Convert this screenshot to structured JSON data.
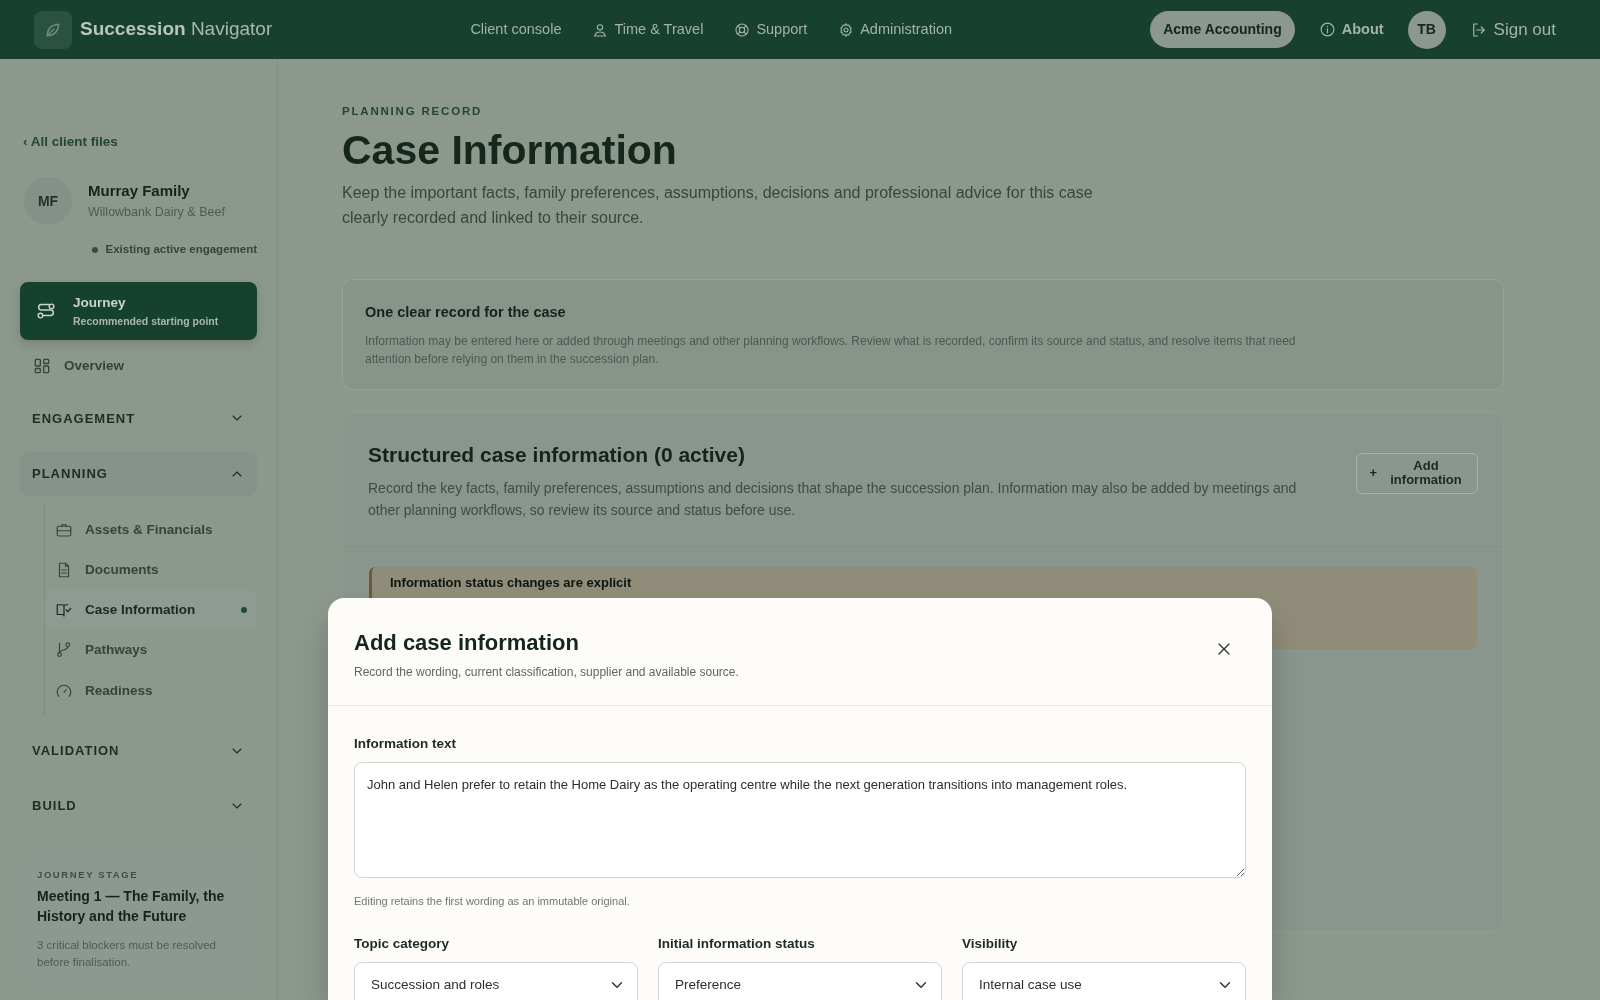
{
  "navbar": {
    "brand_bold": "Succession",
    "brand_light": "Navigator",
    "links": [
      {
        "label": "Client console"
      },
      {
        "label": "Time & Travel"
      },
      {
        "label": "Support"
      },
      {
        "label": "Administration"
      }
    ],
    "organisation": "Acme Accounting",
    "about": "About",
    "avatar": "TB",
    "sign_out": "Sign out"
  },
  "sidebar": {
    "back_link": "‹ All client files",
    "client": {
      "initials": "MF",
      "name": "Murray Family",
      "business": "Willowbank Dairy & Beef",
      "status": "Existing active engagement"
    },
    "journey": {
      "title": "Journey",
      "subtitle": "Recommended starting point"
    },
    "overview": "Overview",
    "sections": [
      {
        "label": "ENGAGEMENT",
        "expanded": false
      },
      {
        "label": "PLANNING",
        "expanded": true,
        "items": [
          {
            "label": "Assets & Financials",
            "selected": false
          },
          {
            "label": "Documents",
            "selected": false
          },
          {
            "label": "Case Information",
            "selected": true
          },
          {
            "label": "Pathways",
            "selected": false
          },
          {
            "label": "Readiness",
            "selected": false
          }
        ]
      },
      {
        "label": "VALIDATION",
        "expanded": false
      },
      {
        "label": "BUILD",
        "expanded": false
      }
    ],
    "stage": {
      "eyebrow": "JOURNEY STAGE",
      "title": "Meeting 1 — The Family, the History and the Future",
      "note": "3 critical blockers must be resolved before finalisation."
    }
  },
  "main": {
    "eyebrow": "PLANNING RECORD",
    "title": "Case Information",
    "intro": "Keep the important facts, family preferences, assumptions, decisions and professional advice for this case clearly recorded and linked to their source.",
    "info_card": {
      "title": "One clear record for the case",
      "text": "Information may be entered here or added through meetings and other planning workflows. Review what is recorded, confirm its source and status, and resolve items that need attention before relying on them in the succession plan."
    },
    "structured": {
      "title": "Structured case information (0 active)",
      "text": "Record the key facts, family preferences, assumptions and decisions that shape the succession plan. Information may also be added by meetings and other planning workflows, so review its source and status before use.",
      "add_button": "Add information",
      "add_icon": "+"
    },
    "callout": {
      "title": "Information status changes are explicit"
    }
  },
  "modal": {
    "title": "Add case information",
    "subtitle": "Record the wording, current classification, supplier and available source.",
    "text_field": {
      "label": "Information text",
      "value": "John and Helen prefer to retain the Home Dairy as the operating centre while the next generation transitions into management roles.",
      "help": "Editing retains the first wording as an immutable original."
    },
    "selects": [
      {
        "label": "Topic category",
        "value": "Succession and roles"
      },
      {
        "label": "Initial information status",
        "value": "Preference"
      },
      {
        "label": "Visibility",
        "value": "Internal case use"
      }
    ]
  }
}
